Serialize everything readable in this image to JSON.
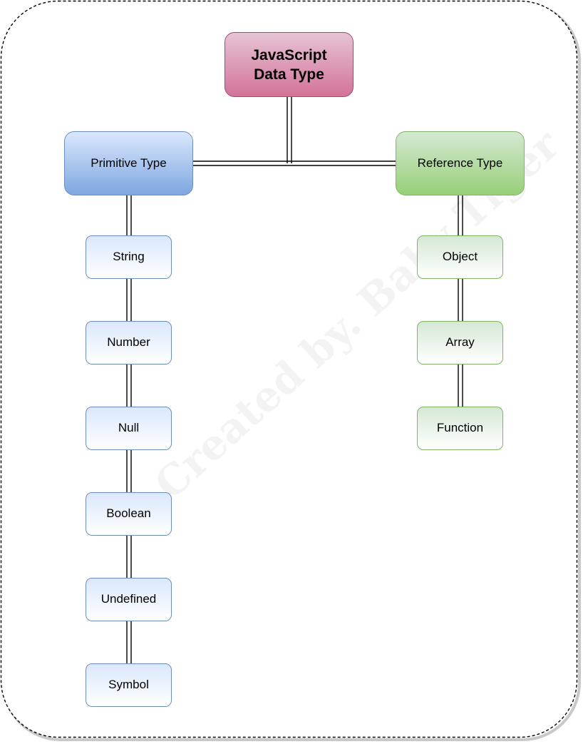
{
  "diagram": {
    "root": {
      "label": "JavaScript Data Type",
      "lines": [
        "JavaScript",
        "Data Type"
      ]
    },
    "branches": [
      {
        "label": "Primitive Type",
        "children": [
          "String",
          "Number",
          "Null",
          "Boolean",
          "Undefined",
          "Symbol"
        ]
      },
      {
        "label": "Reference Type",
        "children": [
          "Object",
          "Array",
          "Function"
        ]
      }
    ],
    "watermark": "Created by. Baby Tiger"
  },
  "colors": {
    "root_fill_top": "#e6c4d6",
    "root_fill_bottom": "#d4729a",
    "primitive_fill": "#dae8fc",
    "primitive_stroke": "#6c8ebf",
    "reference_fill": "#d5e8d4",
    "reference_stroke": "#82b366",
    "connector": "#000000"
  }
}
